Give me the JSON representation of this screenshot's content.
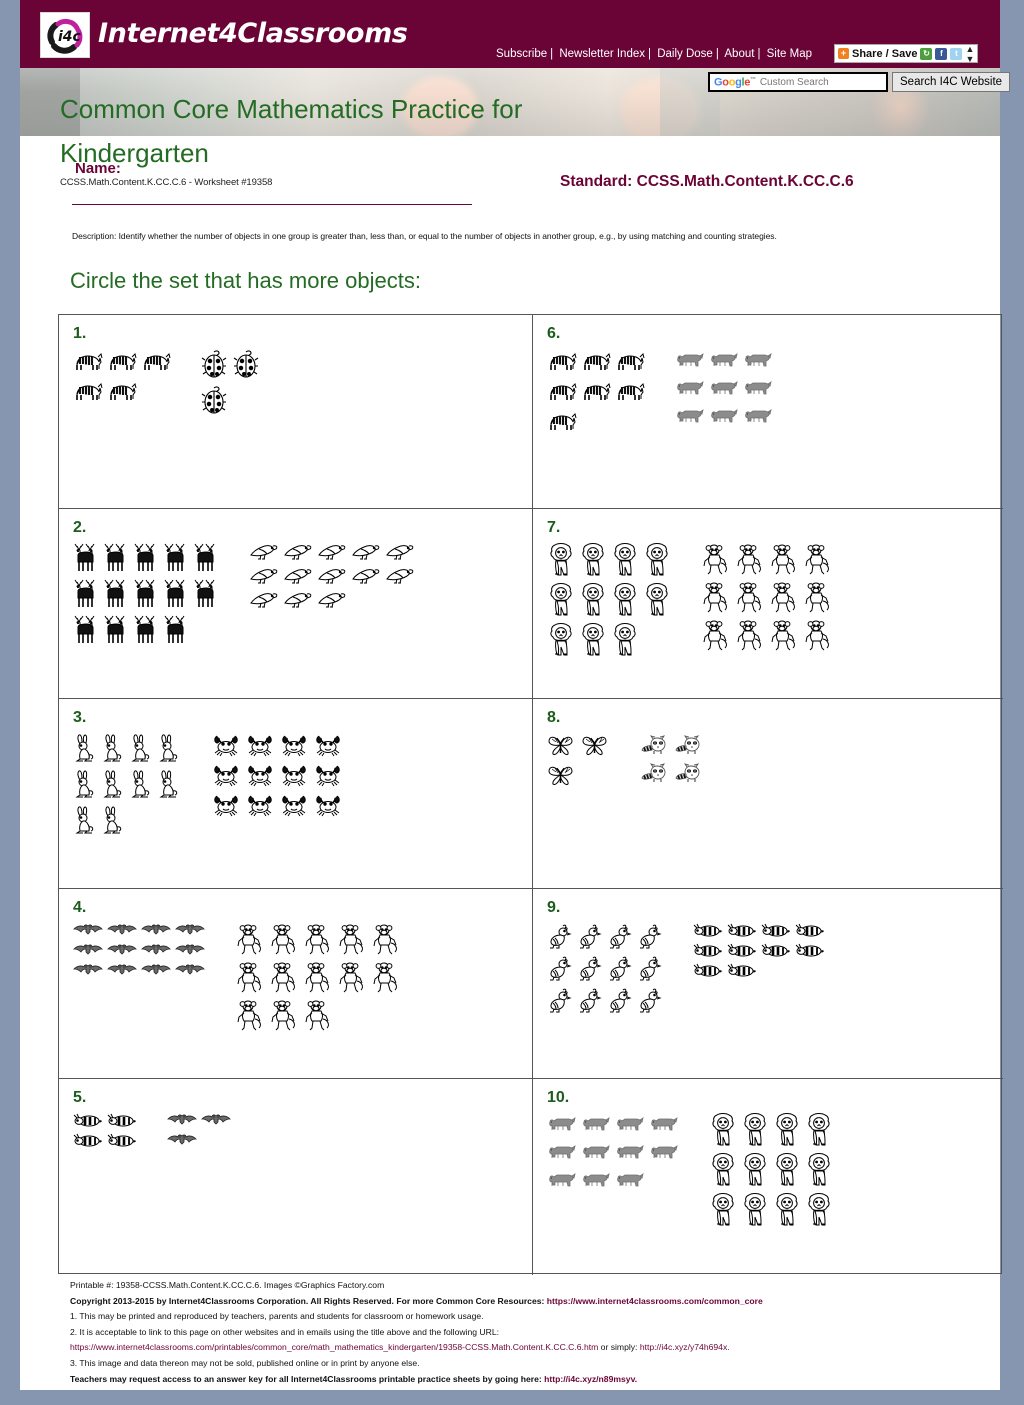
{
  "site": {
    "brand": "Internet4Classrooms",
    "logo_alt": "i4c",
    "nav": [
      "Subscribe",
      "Newsletter Index",
      "Daily Dose",
      "About",
      "Site Map"
    ],
    "share": {
      "label": "Share / Save",
      "icons": [
        "share-plus-icon",
        "addthis-icon",
        "facebook-icon",
        "twitter-icon",
        "caret-icon"
      ]
    },
    "search": {
      "brand": "Google",
      "tm": "™",
      "placeholder": "Custom Search",
      "value": "",
      "button": "Search I4C Website"
    }
  },
  "header": {
    "title_line1": "Common Core Mathematics Practice for",
    "title_line2": "Kindergarten",
    "name_label": "Name:",
    "worksheet_id": "CCSS.Math.Content.K.CC.C.6 - Worksheet #19358",
    "standard": "Standard: CCSS.Math.Content.K.CC.C.6",
    "description": "Description: Identify whether the number of objects in one group is greater than, less than, or equal to the number of objects in another group, e.g., by using matching and counting strategies."
  },
  "instruction": "Circle the set that has more objects:",
  "colors": {
    "maroon": "#6b0436",
    "green": "#246b24",
    "page_bg": "#8696b0"
  },
  "problems": [
    {
      "number": "1.",
      "set_a": {
        "icon": "zebra-icon",
        "count": 5,
        "per_row": 3
      },
      "set_b": {
        "icon": "ladybug-icon",
        "count": 3,
        "per_row": 2
      }
    },
    {
      "number": "6.",
      "set_a": {
        "icon": "zebra-icon",
        "count": 7,
        "per_row": 3
      },
      "set_b": {
        "icon": "bison-icon",
        "count": 9,
        "per_row": 3
      }
    },
    {
      "number": "2.",
      "set_a": {
        "icon": "deer-icon",
        "count": 14,
        "per_row": 5
      },
      "set_b": {
        "icon": "bird-icon",
        "count": 13,
        "per_row": 5
      }
    },
    {
      "number": "7.",
      "set_a": {
        "icon": "lion-icon",
        "count": 11,
        "per_row": 4
      },
      "set_b": {
        "icon": "monkey-icon",
        "count": 12,
        "per_row": 4
      }
    },
    {
      "number": "3.",
      "set_a": {
        "icon": "rabbit-icon",
        "count": 10,
        "per_row": 4
      },
      "set_b": {
        "icon": "crab-icon",
        "count": 12,
        "per_row": 4
      }
    },
    {
      "number": "8.",
      "set_a": {
        "icon": "butterfly-icon",
        "count": 3,
        "per_row": 2
      },
      "set_b": {
        "icon": "raccoon-icon",
        "count": 4,
        "per_row": 2
      }
    },
    {
      "number": "4.",
      "set_a": {
        "icon": "bat-icon",
        "count": 12,
        "per_row": 4
      },
      "set_b": {
        "icon": "monkey-icon",
        "count": 13,
        "per_row": 5
      }
    },
    {
      "number": "9.",
      "set_a": {
        "icon": "chicken-icon",
        "count": 12,
        "per_row": 4
      },
      "set_b": {
        "icon": "bee-icon",
        "count": 10,
        "per_row": 4
      }
    },
    {
      "number": "5.",
      "set_a": {
        "icon": "bee-icon",
        "count": 4,
        "per_row": 2
      },
      "set_b": {
        "icon": "bat-icon",
        "count": 3,
        "per_row": 2
      }
    },
    {
      "number": "10.",
      "set_a": {
        "icon": "bison-icon",
        "count": 11,
        "per_row": 4
      },
      "set_b": {
        "icon": "lion-icon",
        "count": 12,
        "per_row": 4
      }
    }
  ],
  "footer": {
    "line1": "Printable #: 19358-CCSS.Math.Content.K.CC.C.6. Images ©Graphics Factory.com",
    "line2_prefix": "Copyright 2013-2015 by Internet4Classrooms Corporation. All Rights Reserved. For more Common Core Resources: ",
    "line2_link": "https://www.internet4classrooms.com/common_core",
    "line3": "1. This may be printed and reproduced by teachers, parents and students for classroom or homework usage.",
    "line4": "2. It is acceptable to link to this page on other websites and in emails using the title above and the following URL:",
    "line5_link": "https://www.internet4classrooms.com/printables/common_core/math_mathematics_kindergarten/19358-CCSS.Math.Content.K.CC.C.6.htm",
    "line5_mid": " or simply: ",
    "line5_link2": "http://i4c.xyz/y74h694x.",
    "line6": "3. This image and data thereon may not be sold, published online or in print by anyone else.",
    "line7_prefix": "Teachers may request access to an answer key for all Internet4Classrooms printable practice sheets by going here: ",
    "line7_link": "http://i4c.xyz/n89msyv."
  }
}
